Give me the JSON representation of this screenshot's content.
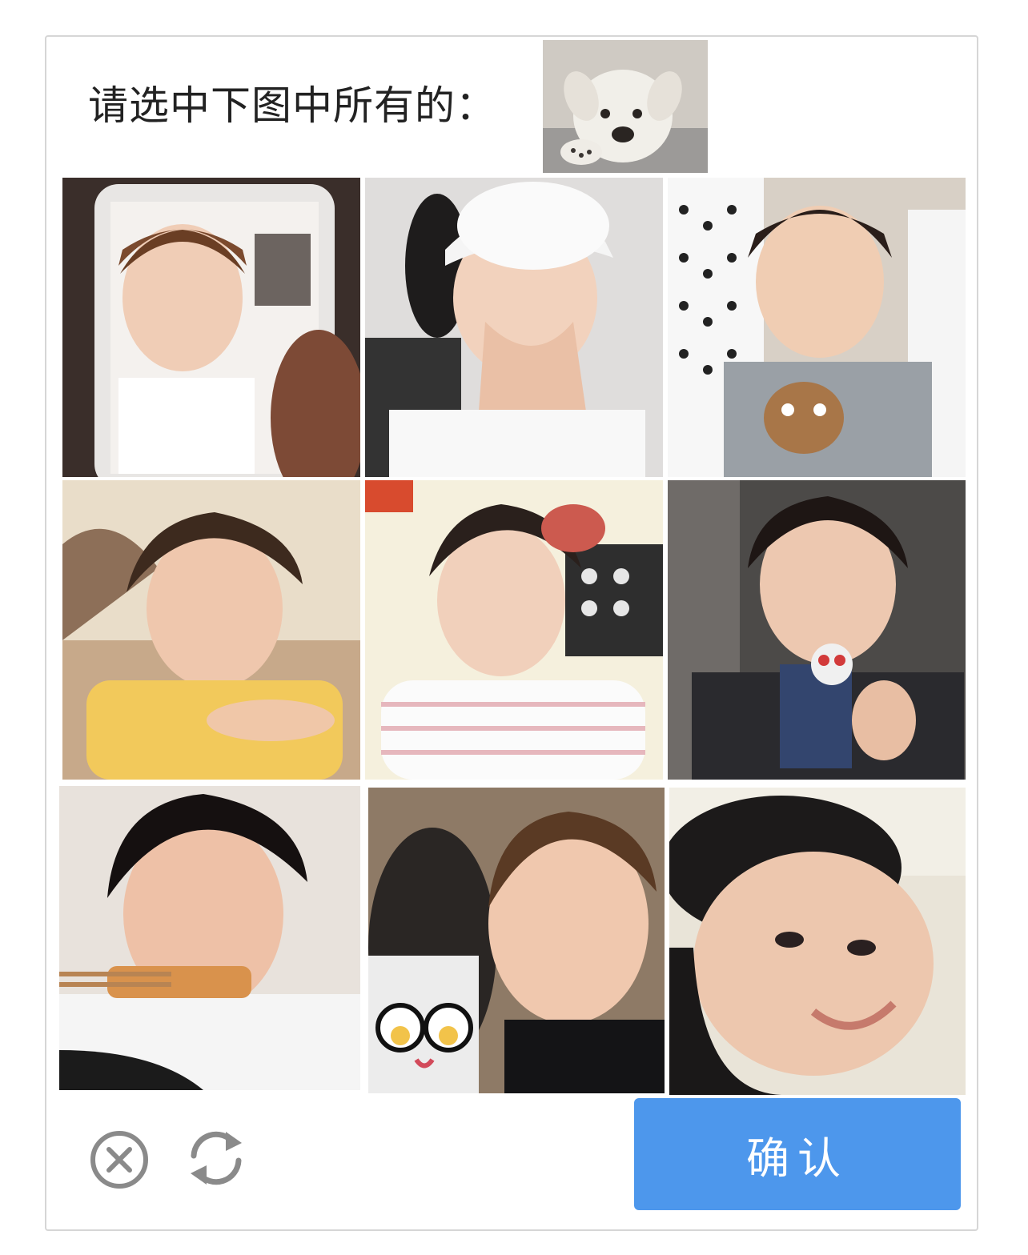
{
  "captcha": {
    "prompt": "请选中下图中所有的：",
    "reference_image": "puppy-photo",
    "tiles": [
      {
        "name": "tile-1",
        "icon": "person-photo"
      },
      {
        "name": "tile-2",
        "icon": "person-photo"
      },
      {
        "name": "tile-3",
        "icon": "person-photo"
      },
      {
        "name": "tile-4",
        "icon": "person-photo"
      },
      {
        "name": "tile-5",
        "icon": "person-photo"
      },
      {
        "name": "tile-6",
        "icon": "person-photo"
      },
      {
        "name": "tile-7",
        "icon": "person-photo"
      },
      {
        "name": "tile-8",
        "icon": "person-photo"
      },
      {
        "name": "tile-9",
        "icon": "person-photo"
      }
    ],
    "footer": {
      "close_icon": "close-circle-icon",
      "refresh_icon": "refresh-icon",
      "confirm_label": "确认"
    },
    "colors": {
      "confirm_bg": "#4d97ec",
      "icon_gray": "#8a8a8a",
      "border": "#d6d6d6"
    }
  }
}
